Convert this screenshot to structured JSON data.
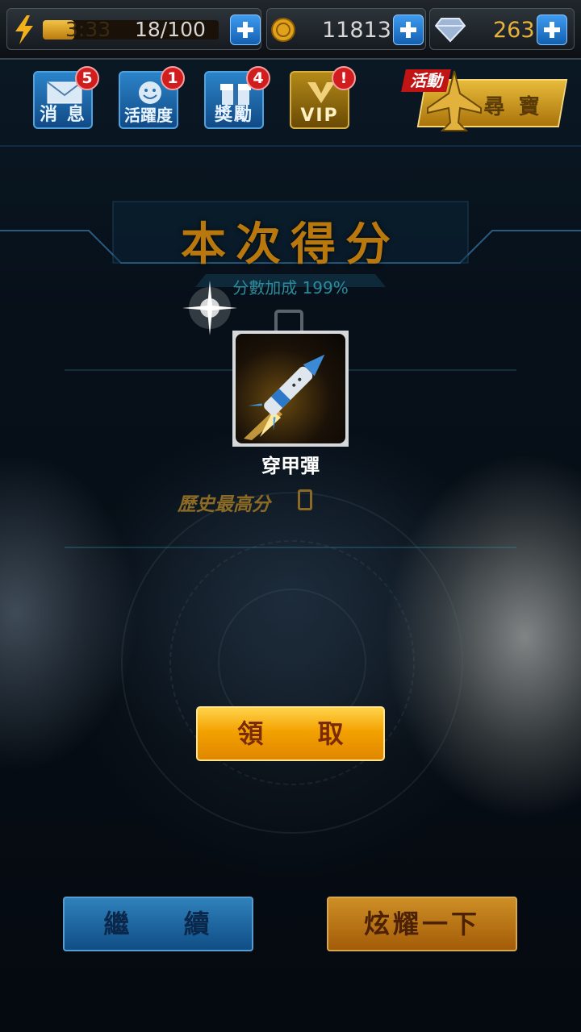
{
  "topbar": {
    "energy_timer": "3:33",
    "energy_count": "18/100",
    "energy_progress": 0.18,
    "gold": "11813",
    "diamonds": "263"
  },
  "nav": [
    {
      "label": "消 息",
      "badge": "5"
    },
    {
      "label": "活躍度",
      "badge": "1"
    },
    {
      "label": "獎勵",
      "badge": "4"
    },
    {
      "label": "VIP",
      "badge": "!"
    }
  ],
  "event": {
    "tag": "活動",
    "label": "尋 寶"
  },
  "result": {
    "title": "本次得分",
    "bonus": "分數加成 199%",
    "high_score_label": "歷史最高分"
  },
  "reward": {
    "name": "穿甲彈"
  },
  "buttons": {
    "claim": "領 取",
    "continue": "繼 續",
    "show_off": "炫耀一下"
  },
  "colors": {
    "accent_gold": "#f3a200",
    "accent_blue": "#2b84c9",
    "badge_red": "#d11d1d"
  }
}
